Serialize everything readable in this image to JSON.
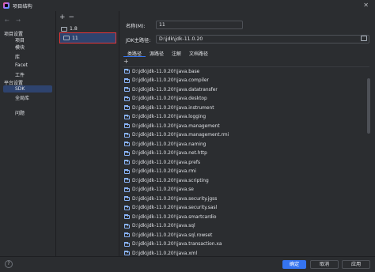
{
  "window": {
    "title": "项目结构",
    "close_glyph": "✕"
  },
  "nav": {
    "back_forward": "← →",
    "project_settings_header": "项目设置",
    "project_items": [
      "项目",
      "模块",
      "库",
      "Facet",
      "工件"
    ],
    "platform_settings_header": "平台设置",
    "platform_items": [
      "SDK",
      "全局库"
    ],
    "selected": "SDK",
    "problems": "问题"
  },
  "tree": {
    "toolbar_add": "+",
    "toolbar_remove": "−",
    "items": [
      {
        "label": "1.8",
        "icon": "folder-icon"
      },
      {
        "label": "11",
        "icon": "folder-icon",
        "selected": true
      }
    ]
  },
  "details": {
    "name_label": "名称(M):",
    "name_value": "11",
    "home_label": "JDK主路径:",
    "home_value": "D:\\jdk\\jdk-11.0.20",
    "tabs": [
      "类路径",
      "源路径",
      "注解",
      "文档路径"
    ],
    "active_tab": "类路径",
    "add_label": "+",
    "classpath": [
      "D:\\jdk\\jdk-11.0.20!\\java.base",
      "D:\\jdk\\jdk-11.0.20!\\java.compiler",
      "D:\\jdk\\jdk-11.0.20!\\java.datatransfer",
      "D:\\jdk\\jdk-11.0.20!\\java.desktop",
      "D:\\jdk\\jdk-11.0.20!\\java.instrument",
      "D:\\jdk\\jdk-11.0.20!\\java.logging",
      "D:\\jdk\\jdk-11.0.20!\\java.management",
      "D:\\jdk\\jdk-11.0.20!\\java.management.rmi",
      "D:\\jdk\\jdk-11.0.20!\\java.naming",
      "D:\\jdk\\jdk-11.0.20!\\java.net.http",
      "D:\\jdk\\jdk-11.0.20!\\java.prefs",
      "D:\\jdk\\jdk-11.0.20!\\java.rmi",
      "D:\\jdk\\jdk-11.0.20!\\java.scripting",
      "D:\\jdk\\jdk-11.0.20!\\java.se",
      "D:\\jdk\\jdk-11.0.20!\\java.security.jgss",
      "D:\\jdk\\jdk-11.0.20!\\java.security.sasl",
      "D:\\jdk\\jdk-11.0.20!\\java.smartcardio",
      "D:\\jdk\\jdk-11.0.20!\\java.sql",
      "D:\\jdk\\jdk-11.0.20!\\java.sql.rowset",
      "D:\\jdk\\jdk-11.0.20!\\java.transaction.xa",
      "D:\\jdk\\jdk-11.0.20!\\java.xml"
    ]
  },
  "footer": {
    "help": "?",
    "ok": "确定",
    "cancel": "取消",
    "apply": "应用"
  },
  "colors": {
    "background": "#2b2d30",
    "selection": "#2e436e",
    "accent": "#3574f0",
    "highlight_border": "#e5363c"
  }
}
